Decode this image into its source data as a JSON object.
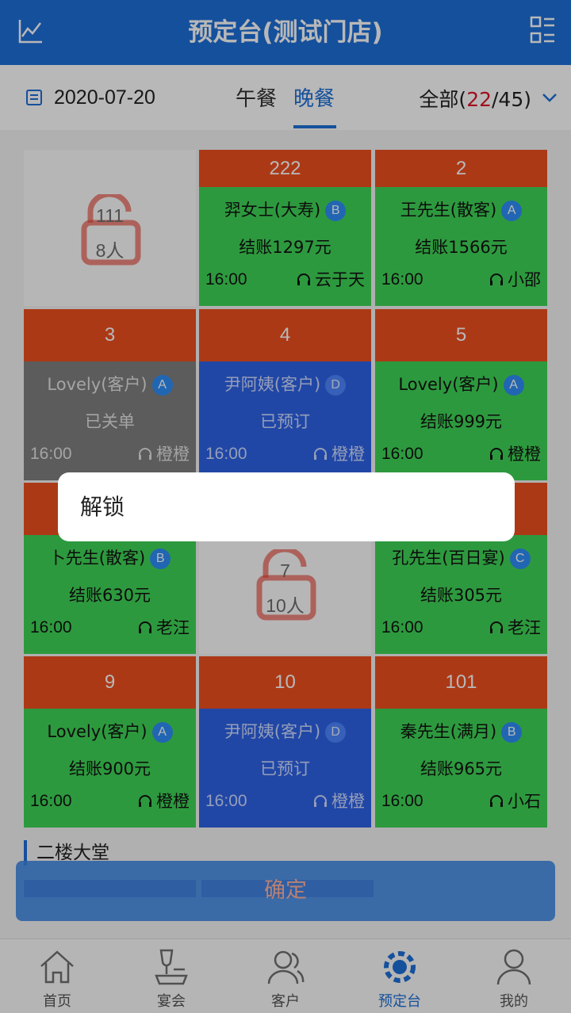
{
  "header": {
    "title": "预定台(测试门店)",
    "left_icon": "chart-line-icon",
    "right_icon": "menu-list-icon"
  },
  "filter_bar": {
    "date": "2020-07-20",
    "tabs": [
      {
        "label": "午餐",
        "active": false
      },
      {
        "label": "晚餐",
        "active": true
      }
    ],
    "summary_prefix": "全部(",
    "summary_used": "22",
    "summary_rest": "/45)"
  },
  "tables": [
    {
      "number": "222",
      "name": "羿女士(大寿)",
      "badge": "B",
      "status": "结账1297元",
      "time": "16:00",
      "staff": "云于天",
      "color": "green"
    },
    {
      "number": "2",
      "name": "王先生(散客)",
      "badge": "A",
      "status": "结账1566元",
      "time": "16:00",
      "staff": "小邵",
      "color": "green"
    },
    {
      "number": "3",
      "name": "Lovely(客户)",
      "badge": "A",
      "status": "已关单",
      "time": "16:00",
      "staff": "橙橙",
      "color": "gray"
    },
    {
      "number": "4",
      "name": "尹阿姨(客户)",
      "badge": "D",
      "status": "已预订",
      "time": "16:00",
      "staff": "橙橙",
      "color": "blue"
    },
    {
      "number": "5",
      "name": "Lovely(客户)",
      "badge": "A",
      "status": "结账999元",
      "time": "16:00",
      "staff": "橙橙",
      "color": "green"
    },
    {
      "name": "卜先生(散客)",
      "badge": "B",
      "status": "结账630元",
      "time": "16:00",
      "staff": "老汪",
      "color": "green"
    },
    {
      "name": "孔先生(百日宴)",
      "badge": "C",
      "status": "结账305元",
      "time": "16:00",
      "staff": "老汪",
      "color": "green"
    },
    {
      "number": "9",
      "name": "Lovely(客户)",
      "badge": "A",
      "status": "结账900元",
      "time": "16:00",
      "staff": "橙橙",
      "color": "green"
    },
    {
      "number": "10",
      "name": "尹阿姨(客户)",
      "badge": "D",
      "status": "已预订",
      "time": "16:00",
      "staff": "橙橙",
      "color": "blue"
    },
    {
      "number": "101",
      "name": "秦先生(满月)",
      "badge": "B",
      "status": "结账965元",
      "time": "16:00",
      "staff": "小石",
      "color": "green"
    }
  ],
  "locked_tables": [
    {
      "number": "111",
      "people": "8人"
    },
    {
      "number": "7",
      "people": "10人"
    }
  ],
  "section_title": "二楼大堂",
  "confirm_label": "确定",
  "popup": {
    "label": "解锁"
  },
  "nav": [
    {
      "label": "首页",
      "icon": "home-icon",
      "active": false
    },
    {
      "label": "宴会",
      "icon": "banquet-icon",
      "active": false
    },
    {
      "label": "客户",
      "icon": "customers-icon",
      "active": false
    },
    {
      "label": "预定台",
      "icon": "booking-desk-icon",
      "active": true
    },
    {
      "label": "我的",
      "icon": "profile-icon",
      "active": false
    }
  ],
  "colors": {
    "primary": "#1e6fd9",
    "table_number_bg": "#ef4f1f",
    "card_green": "#3fd457",
    "card_blue": "#2f63e6",
    "card_gray": "#808080",
    "highlight_red": "#e0142a",
    "lock_red": "#e84a3c"
  }
}
